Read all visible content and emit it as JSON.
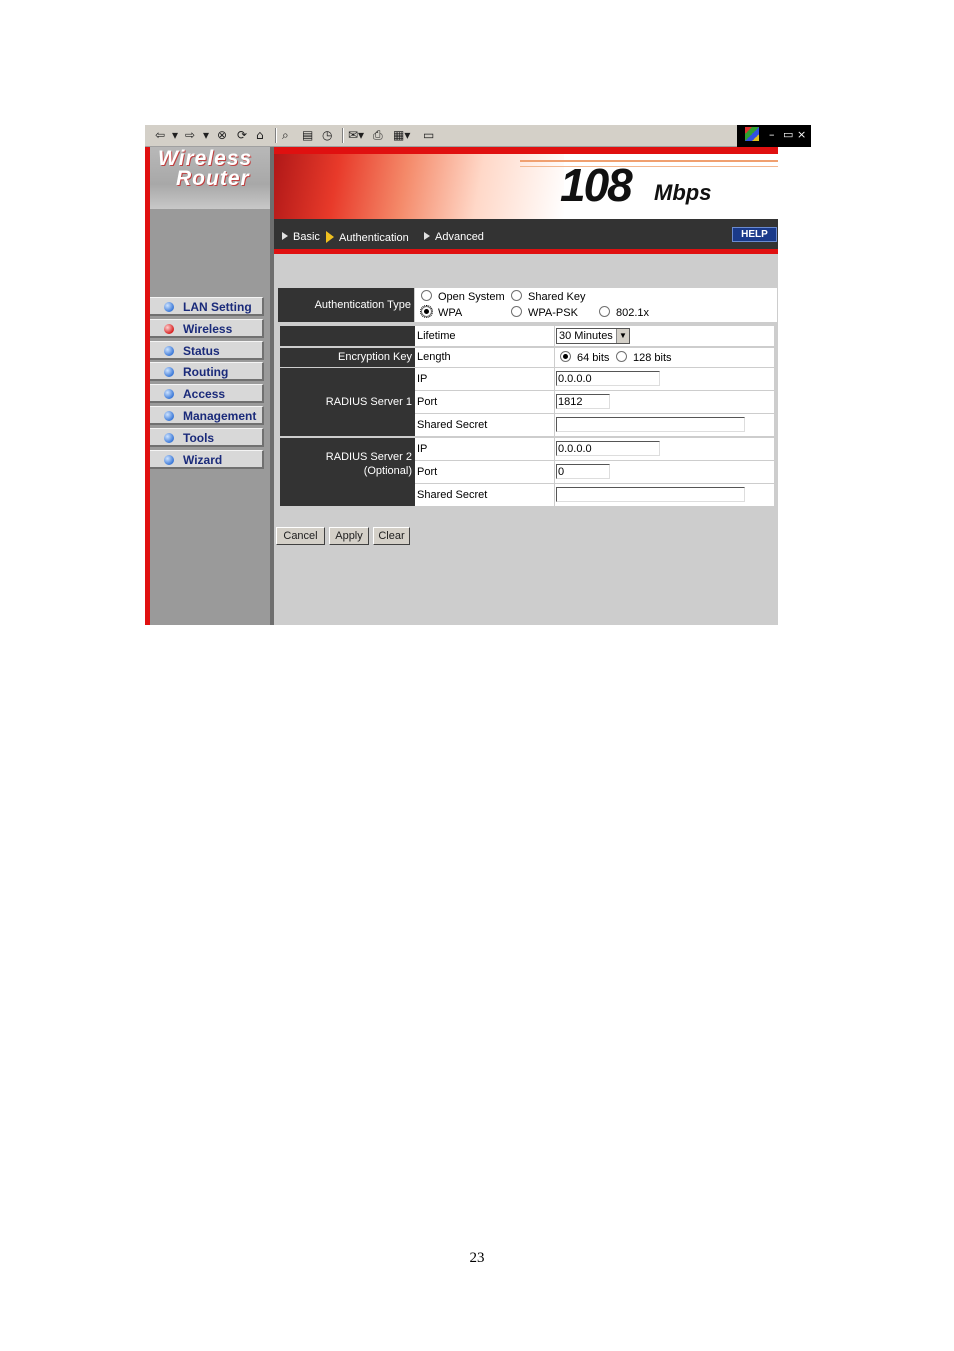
{
  "toolbar": {
    "back": "⇦",
    "forward": "⇨",
    "glyphs": [
      "▾",
      "▾",
      "⊗",
      "⟳",
      "⌂",
      "⌕",
      "▤",
      "◷",
      "✉▾",
      "⎙",
      "▦▾",
      "▭"
    ]
  },
  "window_controls": {
    "minimize": "–",
    "restore": "▭",
    "close": "×"
  },
  "logo": {
    "line1": "Wireless",
    "line2": "Router"
  },
  "banner": {
    "speed": "108",
    "unit": "Mbps"
  },
  "nav": {
    "tabs": [
      {
        "label": "Basic",
        "active": false
      },
      {
        "label": "Authentication",
        "active": true
      },
      {
        "label": "Advanced",
        "active": false
      }
    ],
    "help": "HELP"
  },
  "sidebar": {
    "items": [
      {
        "label": "LAN Setting",
        "active": false
      },
      {
        "label": "Wireless",
        "active": true
      },
      {
        "label": "Status",
        "active": false
      },
      {
        "label": "Routing",
        "active": false
      },
      {
        "label": "Access",
        "active": false
      },
      {
        "label": "Management",
        "active": false
      },
      {
        "label": "Tools",
        "active": false
      },
      {
        "label": "Wizard",
        "active": false
      }
    ]
  },
  "form": {
    "auth_type": {
      "label": "Authentication Type",
      "options": [
        {
          "label": "Open System",
          "selected": false
        },
        {
          "label": "Shared Key",
          "selected": false
        },
        {
          "label": "WPA",
          "selected": true
        },
        {
          "label": "WPA-PSK",
          "selected": false
        },
        {
          "label": "802.1x",
          "selected": false
        }
      ]
    },
    "lifetime": {
      "label": "Lifetime",
      "value": "30 Minutes"
    },
    "encryption": {
      "label": "Encryption Key",
      "sub_label": "Length",
      "options": [
        {
          "label": "64 bits",
          "selected": true
        },
        {
          "label": "128 bits",
          "selected": false
        }
      ]
    },
    "radius1": {
      "label": "RADIUS Server 1",
      "ip_label": "IP",
      "ip_value": "0.0.0.0",
      "port_label": "Port",
      "port_value": "1812",
      "secret_label": "Shared Secret",
      "secret_value": ""
    },
    "radius2": {
      "label": "RADIUS Server 2",
      "label_sub": "(Optional)",
      "ip_label": "IP",
      "ip_value": "0.0.0.0",
      "port_label": "Port",
      "port_value": "0",
      "secret_label": "Shared Secret",
      "secret_value": ""
    }
  },
  "buttons": {
    "cancel": "Cancel",
    "apply": "Apply",
    "clear": "Clear"
  },
  "page_number": "23",
  "colors": {
    "accent_red": "#e01010",
    "nav_dark": "#333333",
    "menu_text": "#1a2a7a"
  }
}
